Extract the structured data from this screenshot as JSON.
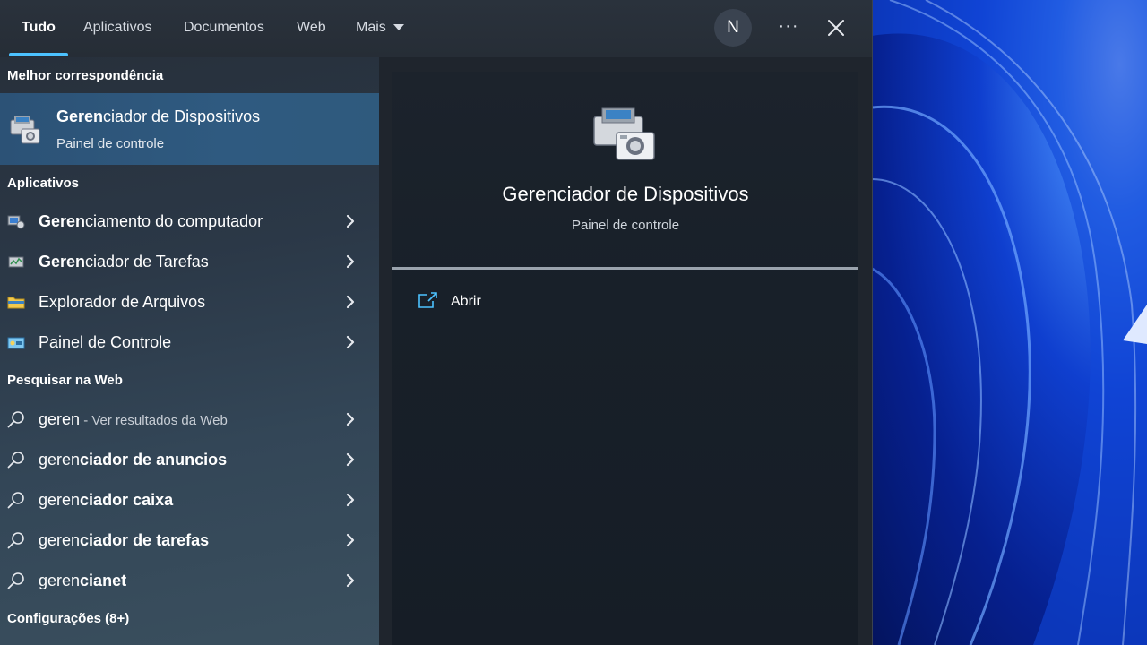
{
  "tabs": [
    {
      "label": "Tudo"
    },
    {
      "label": "Aplicativos"
    },
    {
      "label": "Documentos"
    },
    {
      "label": "Web"
    },
    {
      "label": "Mais"
    }
  ],
  "avatar_initial": "N",
  "more_label": "···",
  "sections": {
    "best": "Melhor correspondência",
    "apps": "Aplicativos",
    "web": "Pesquisar na Web",
    "settings": "Configurações (8+)"
  },
  "best_match": {
    "title_bold": "Geren",
    "title_rest": "ciador de Dispositivos",
    "subtitle": "Painel de controle",
    "icon": "device-manager-icon"
  },
  "apps": [
    {
      "bold": "Geren",
      "rest": "ciamento do computador",
      "icon": "computer-management-icon"
    },
    {
      "bold": "Geren",
      "rest": "ciador de Tarefas",
      "icon": "task-manager-icon"
    },
    {
      "bold": "",
      "rest": "Explorador de Arquivos",
      "icon": "file-explorer-icon"
    },
    {
      "bold": "",
      "rest": "Painel de Controle",
      "icon": "control-panel-icon"
    }
  ],
  "web": [
    {
      "normal": "geren",
      "suffix": " - Ver resultados da Web",
      "bold": ""
    },
    {
      "normal": "geren",
      "suffix": "",
      "bold": "ciador de anuncios"
    },
    {
      "normal": "geren",
      "suffix": "",
      "bold": "ciador caixa"
    },
    {
      "normal": "geren",
      "suffix": "",
      "bold": "ciador de tarefas"
    },
    {
      "normal": "geren",
      "suffix": "",
      "bold": "cianet"
    }
  ],
  "preview": {
    "title": "Gerenciador de Dispositivos",
    "subtitle": "Painel de controle",
    "open_label": "Abrir"
  },
  "colors": {
    "accent": "#4cc2ff",
    "selected_row": "#2f5a80"
  }
}
